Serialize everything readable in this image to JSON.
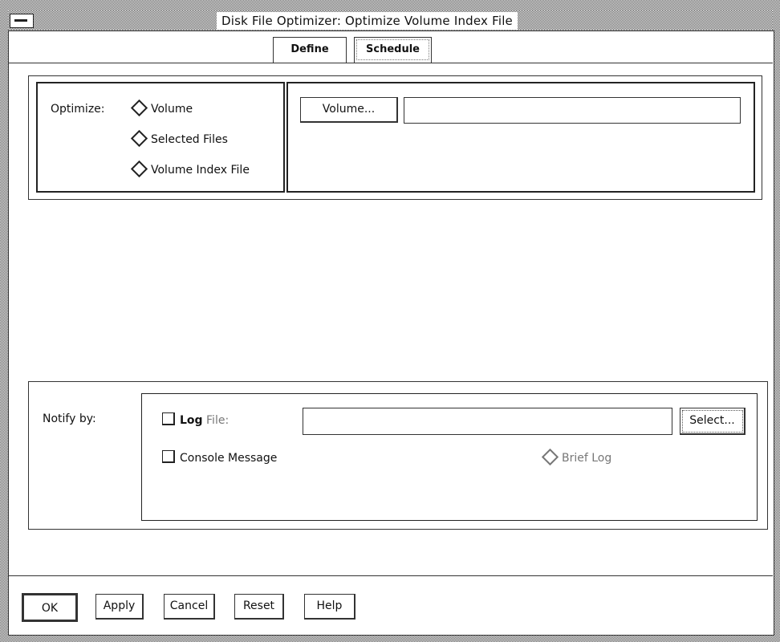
{
  "window": {
    "title": "Disk File Optimizer: Optimize Volume Index File"
  },
  "tabs": [
    {
      "label": "Define",
      "active": true
    },
    {
      "label": "Schedule",
      "active": false
    }
  ],
  "optimize": {
    "label": "Optimize:",
    "options": [
      "Volume",
      "Selected Files",
      "Volume Index File"
    ],
    "volume_button": "Volume...",
    "volume_value": ""
  },
  "notify": {
    "label": "Notify by:",
    "log_file_prefix": "Log",
    "log_file_label": "File:",
    "log_file_value": "",
    "select_button": "Select...",
    "console_message": "Console Message",
    "brief_log": "Brief Log"
  },
  "footer": {
    "ok": "OK",
    "apply": "Apply",
    "cancel": "Cancel",
    "reset": "Reset",
    "help": "Help"
  }
}
